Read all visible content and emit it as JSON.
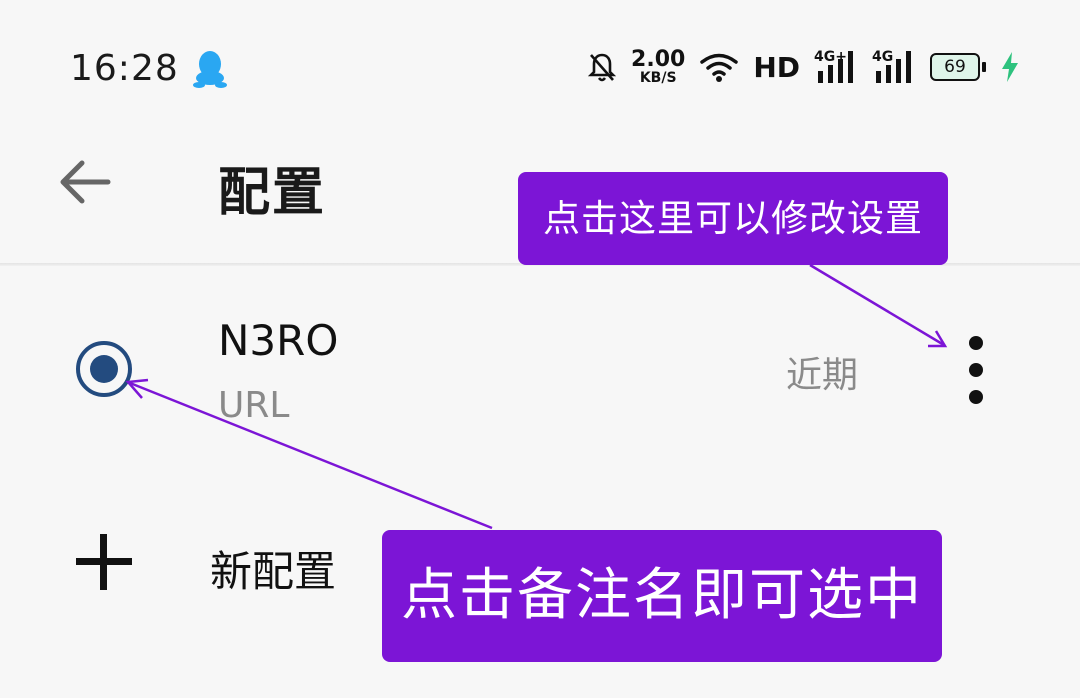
{
  "status_bar": {
    "time": "16:28",
    "net_speed_value": "2.00",
    "net_speed_unit": "KB/S",
    "hd_label": "HD",
    "signal1_label": "4G+",
    "signal2_label": "4G",
    "battery_level": "69",
    "icons": [
      "qq-icon",
      "bell-off-icon",
      "wifi-icon",
      "signal-icon",
      "battery-icon",
      "charging-bolt-icon"
    ]
  },
  "app_bar": {
    "title": "配置",
    "back_icon": "arrow-left-icon"
  },
  "profiles": [
    {
      "name": "N3RO",
      "subtitle": "URL",
      "recent_label": "近期",
      "selected": true
    }
  ],
  "new_profile_label": "新配置",
  "annotations": {
    "top_callout": "点击这里可以修改设置",
    "bottom_callout": "点击备注名即可选中",
    "color": "#7c15d6"
  }
}
